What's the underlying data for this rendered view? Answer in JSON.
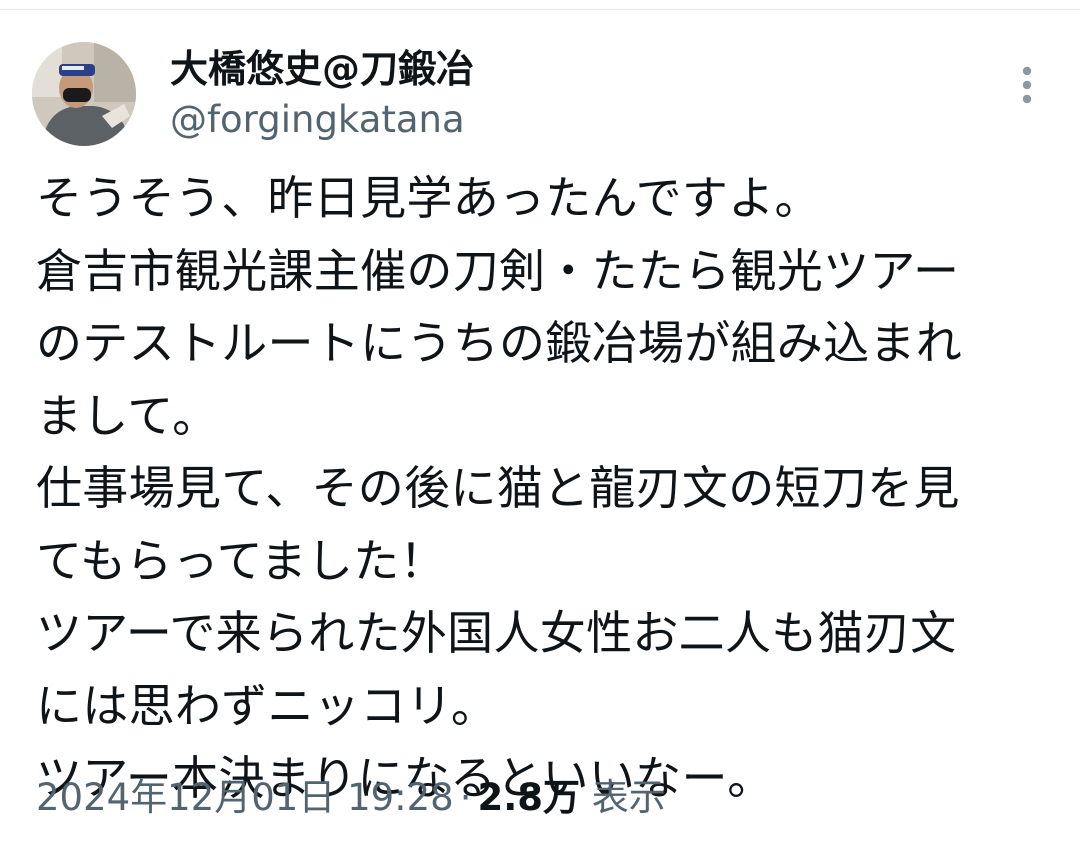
{
  "tweet": {
    "author": {
      "display_name": "大橋悠史@刀鍛冶",
      "handle": "@forgingkatana",
      "avatar_icon": "user-avatar-photo"
    },
    "more_icon": "more-vertical-icon",
    "text_lines": [
      "そうそう、昨日見学あったんですよ。",
      "倉吉市観光課主催の刀剣・たたら観光ツアー",
      "のテストルートにうちの鍛冶場が組み込まれ",
      "まして。",
      "仕事場見て、その後に猫と龍刃文の短刀を見",
      "てもらってました！",
      "ツアーで来られた外国人女性お二人も猫刃文",
      "には思わずニッコリ。",
      "ツアー本決まりになるといいなー。"
    ],
    "timestamp": "2024年12月01日 19:28",
    "separator": "·",
    "views_count": "2.8万",
    "views_label": "表示"
  },
  "colors": {
    "text_primary": "#0f1419",
    "text_secondary": "#536471",
    "icon_muted": "#8b98a5",
    "divider": "#e6ecf0",
    "background": "#ffffff"
  }
}
